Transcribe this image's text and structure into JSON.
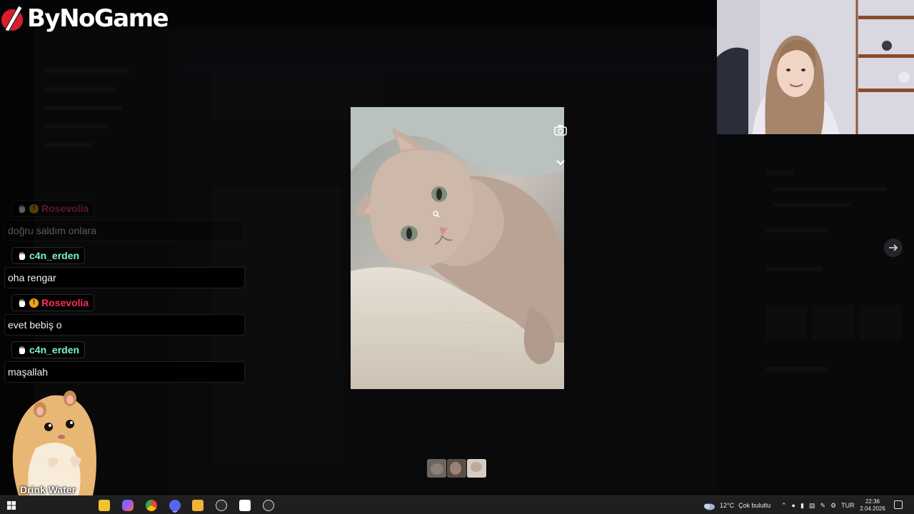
{
  "brand": {
    "name": "ByNoGame"
  },
  "chat": {
    "messages": [
      {
        "user": "",
        "text": "doğru saldım onlara",
        "user_color": "#ff2d55",
        "badges": [
          "hand",
          "coin"
        ]
      },
      {
        "user": "c4n_erden",
        "text": "oha rengar",
        "user_color": "#7df5c8",
        "badges": [
          "hand"
        ]
      },
      {
        "user": "Rosevolia",
        "text": "evet bebiş o",
        "user_color": "#ff2d55",
        "badges": [
          "hand",
          "coin"
        ]
      },
      {
        "user": "c4n_erden",
        "text": "maşallah",
        "user_color": "#7df5c8",
        "badges": [
          "hand"
        ]
      }
    ],
    "faded_user": "Rosevolia"
  },
  "hamster": {
    "label": "Drink Water"
  },
  "viewer": {
    "thumbnails": [
      "cat-photo-1",
      "cat-photo-2",
      "cat-photo-3"
    ],
    "selected_thumbnail": 2
  },
  "taskbar": {
    "apps": [
      "start",
      "search",
      "file-explorer",
      "copilot",
      "chrome",
      "discord",
      "media-app",
      "player",
      "capcut",
      "obs"
    ],
    "weather": {
      "temp": "12°C",
      "condition": "Çok bulutlu"
    },
    "language": "TUR",
    "clock": {
      "time": "22:36",
      "date": "2.04.2026"
    }
  },
  "colors": {
    "accent_red": "#ff2d55",
    "accent_green": "#7df5c8",
    "taskbar": "#1f1f1f"
  }
}
